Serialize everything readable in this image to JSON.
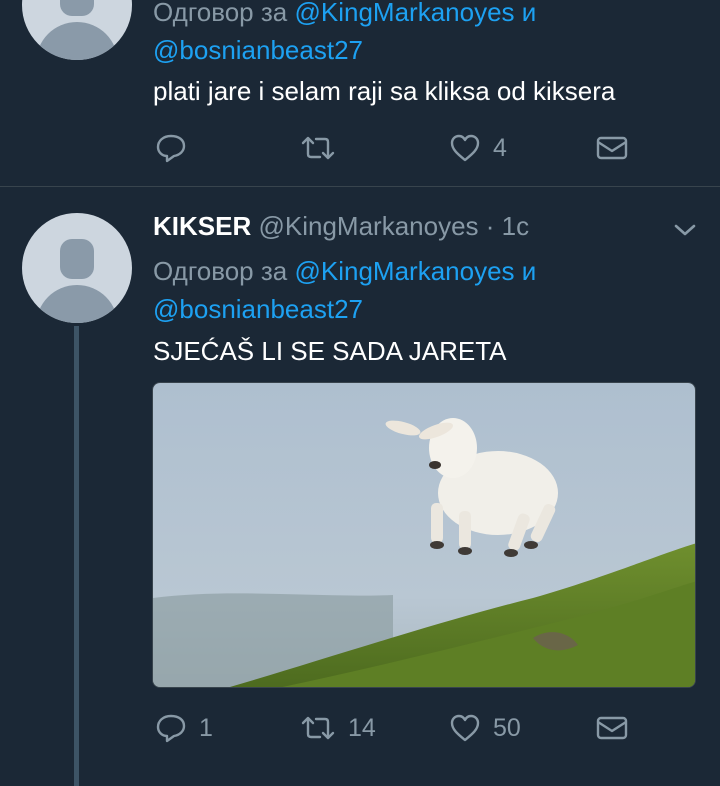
{
  "tweet1": {
    "reply_prefix": "Одговор за",
    "mention1": "@KingMarkanoyes",
    "conj": "и",
    "mention2": "@bosnianbeast27",
    "text": "plati jare i selam raji sa kliksa od kiksera",
    "actions": {
      "replies": "",
      "retweets": "",
      "likes": "4"
    }
  },
  "tweet2": {
    "display_name": "KIKSER",
    "handle": "@KingMarkanoyes",
    "time": "· 1с",
    "reply_prefix": "Одговор за",
    "mention1": "@KingMarkanoyes",
    "conj": "и",
    "mention2": "@bosnianbeast27",
    "text": "SJEĆAŠ LI SE SADA JARETA",
    "actions": {
      "replies": "1",
      "retweets": "14",
      "likes": "50"
    }
  },
  "icons": [
    "reply-icon",
    "retweet-icon",
    "like-icon",
    "dm-icon",
    "chevron-down-icon"
  ],
  "colors": {
    "background": "#1b2836",
    "accent": "#1da1f2",
    "muted": "#8899a6",
    "divider": "#38444d"
  }
}
